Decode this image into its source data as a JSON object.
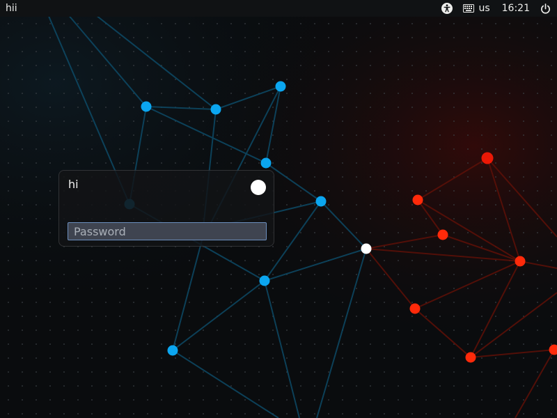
{
  "topbar": {
    "hostname": "hii",
    "keyboard_layout": "us",
    "clock": "16:21",
    "icons": [
      "accessibility-icon",
      "keyboard-icon",
      "power-icon"
    ]
  },
  "login": {
    "username": "hi",
    "password_placeholder": "Password",
    "password_value": ""
  },
  "colors": {
    "topbar_bg": "#101214",
    "blue_node": "#0ba6f0",
    "red_node": "#ff2a0a",
    "input_border": "#6d8fbf"
  }
}
